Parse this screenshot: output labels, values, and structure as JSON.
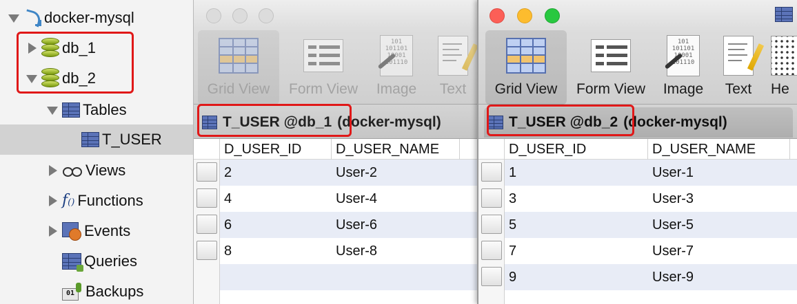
{
  "sidebar": {
    "connection": "docker-mysql",
    "databases": [
      {
        "name": "db_1",
        "expanded": false
      },
      {
        "name": "db_2",
        "expanded": true
      }
    ],
    "tables_label": "Tables",
    "selected_table": "T_USER",
    "views_label": "Views",
    "functions_label": "Functions",
    "events_label": "Events",
    "queries_label": "Queries",
    "backups_label": "Backups",
    "fx_glyph": "f",
    "fx_sub": "()"
  },
  "toolbar": {
    "grid_view": "Grid View",
    "form_view": "Form View",
    "image": "Image",
    "text": "Text",
    "hex_truncated": "He"
  },
  "image_icon_text": [
    "101",
    "101101",
    "10001",
    "101110"
  ],
  "windows": [
    {
      "tab_name": "T_USER @db_1",
      "tab_connection": "(docker-mysql)",
      "columns": [
        "D_USER_ID",
        "D_USER_NAME"
      ],
      "rows": [
        [
          "2",
          "User-2"
        ],
        [
          "4",
          "User-4"
        ],
        [
          "6",
          "User-6"
        ],
        [
          "8",
          "User-8"
        ]
      ]
    },
    {
      "tab_name": "T_USER @db_2",
      "tab_connection": "(docker-mysql)",
      "columns": [
        "D_USER_ID",
        "D_USER_NAME"
      ],
      "rows": [
        [
          "1",
          "User-1"
        ],
        [
          "3",
          "User-3"
        ],
        [
          "5",
          "User-5"
        ],
        [
          "7",
          "User-7"
        ],
        [
          "9",
          "User-9"
        ]
      ]
    }
  ],
  "colors": {
    "highlight": "#e01818",
    "selected_row": "#d2d2d2",
    "alt_row": "#e8ecf6"
  }
}
